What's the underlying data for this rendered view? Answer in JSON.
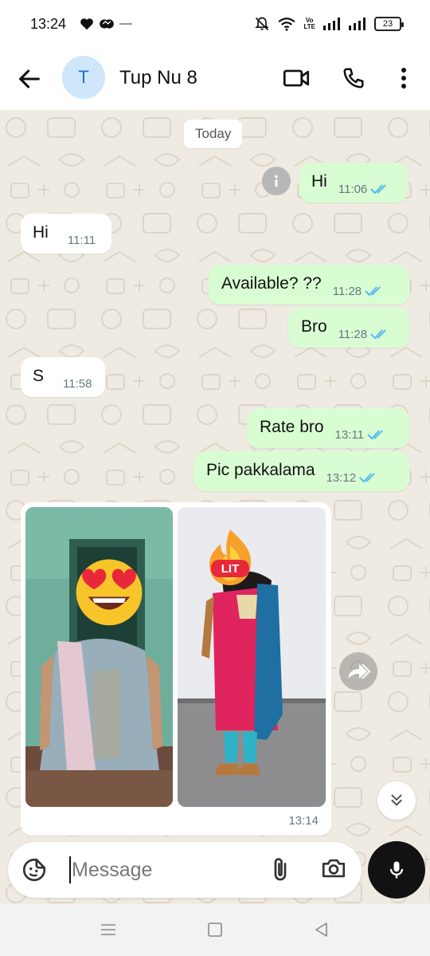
{
  "status_bar": {
    "time": "13:24",
    "volte_line1": "Vo",
    "volte_line2": "LTE",
    "battery": "23"
  },
  "header": {
    "avatar_initial": "T",
    "contact_name": "Tup Nu 8"
  },
  "chat": {
    "date_chip": "Today",
    "messages": [
      {
        "direction": "outgoing",
        "text": "Hi",
        "time": "11:06",
        "status": "read"
      },
      {
        "direction": "incoming",
        "text": "Hi",
        "time": "11:11"
      },
      {
        "direction": "outgoing",
        "text": "Available? ??",
        "time": "11:28",
        "status": "read"
      },
      {
        "direction": "outgoing",
        "text": "Bro",
        "time": "11:28",
        "status": "read"
      },
      {
        "direction": "incoming",
        "text": "S",
        "time": "11:58"
      },
      {
        "direction": "outgoing",
        "text": "Rate bro",
        "time": "13:11",
        "status": "read"
      },
      {
        "direction": "outgoing",
        "text": "Pic pakkalama",
        "time": "13:12",
        "status": "read"
      }
    ],
    "photo_message": {
      "direction": "incoming",
      "time": "13:14",
      "photos": [
        {
          "sticker": "heart-eyes-emoji"
        },
        {
          "sticker": "lit-fire-emoji",
          "sticker_text": "LIT"
        }
      ]
    }
  },
  "composer": {
    "placeholder": "Message"
  },
  "colors": {
    "outgoing_bubble": "#d9fdd3",
    "incoming_bubble": "#ffffff",
    "chat_background": "#efeae2",
    "read_ticks": "#53bdeb",
    "avatar_bg": "#cfe6fb",
    "avatar_fg": "#1570d6"
  }
}
